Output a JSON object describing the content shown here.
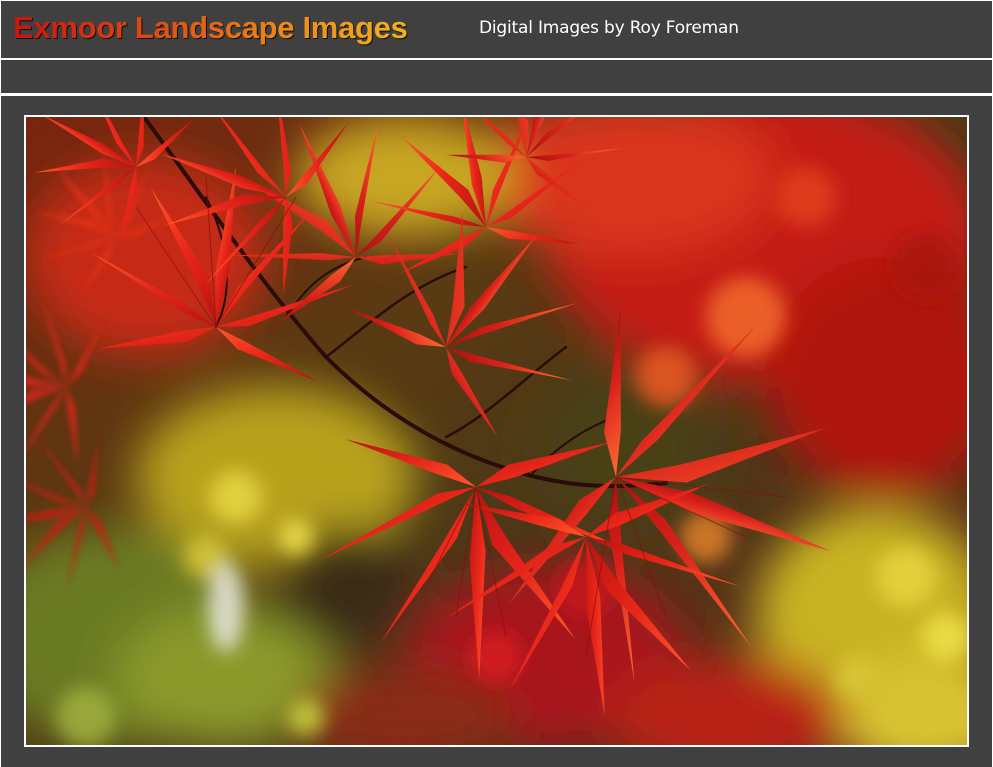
{
  "header": {
    "title": "Exmoor Landscape Images",
    "subtitle": "Digital Images by Roy Foreman"
  },
  "navigation": {
    "items": []
  },
  "photo": {
    "subject": "red-maple-leaves-photo"
  },
  "colors": {
    "background": "#404040",
    "divider": "#ffffff",
    "title_gradient_start": "#c8140e",
    "title_gradient_end": "#f3b21e",
    "subtitle": "#ffffff"
  }
}
